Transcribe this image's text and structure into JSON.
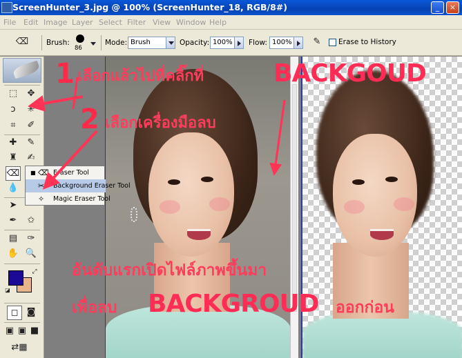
{
  "window": {
    "title": "ScreenHunter_3.jpg @ 100% (ScreenHunter_18, RGB/8#)",
    "minimize": "_",
    "close": "×"
  },
  "menu": [
    "File",
    "Edit",
    "Image",
    "Layer",
    "Select",
    "Filter",
    "View",
    "Window",
    "Help"
  ],
  "options": {
    "brush_label": "Brush:",
    "brush_size": "86",
    "mode_label": "Mode:",
    "mode_value": "Brush",
    "opacity_label": "Opacity:",
    "opacity_value": "100%",
    "flow_label": "Flow:",
    "flow_value": "100%",
    "erase_history_label": "Erase to History"
  },
  "flyout": {
    "items": [
      {
        "label": "Eraser Tool"
      },
      {
        "label": "Background Eraser Tool"
      },
      {
        "label": "Magic Eraser Tool"
      }
    ]
  },
  "colors": {
    "foreground": "#1a0a96",
    "background": "#e8b68c",
    "annotation": "#ff3355"
  },
  "annotations": {
    "step1_num": "1",
    "step1_text": "เลือกแล้วไปที่คลิ๊กที่",
    "step1_word": "BACKGOUD",
    "step2_num": "2",
    "step2_text": "เลือกเครื่องมือลบ",
    "note_line1": "อันดับแรกเปิดไฟล์ภาพขึ้นมา",
    "note_line2_a": "เพื่อลบ",
    "note_line2_word": "BACKGROUD",
    "note_line2_b": "ออกก่อน"
  }
}
